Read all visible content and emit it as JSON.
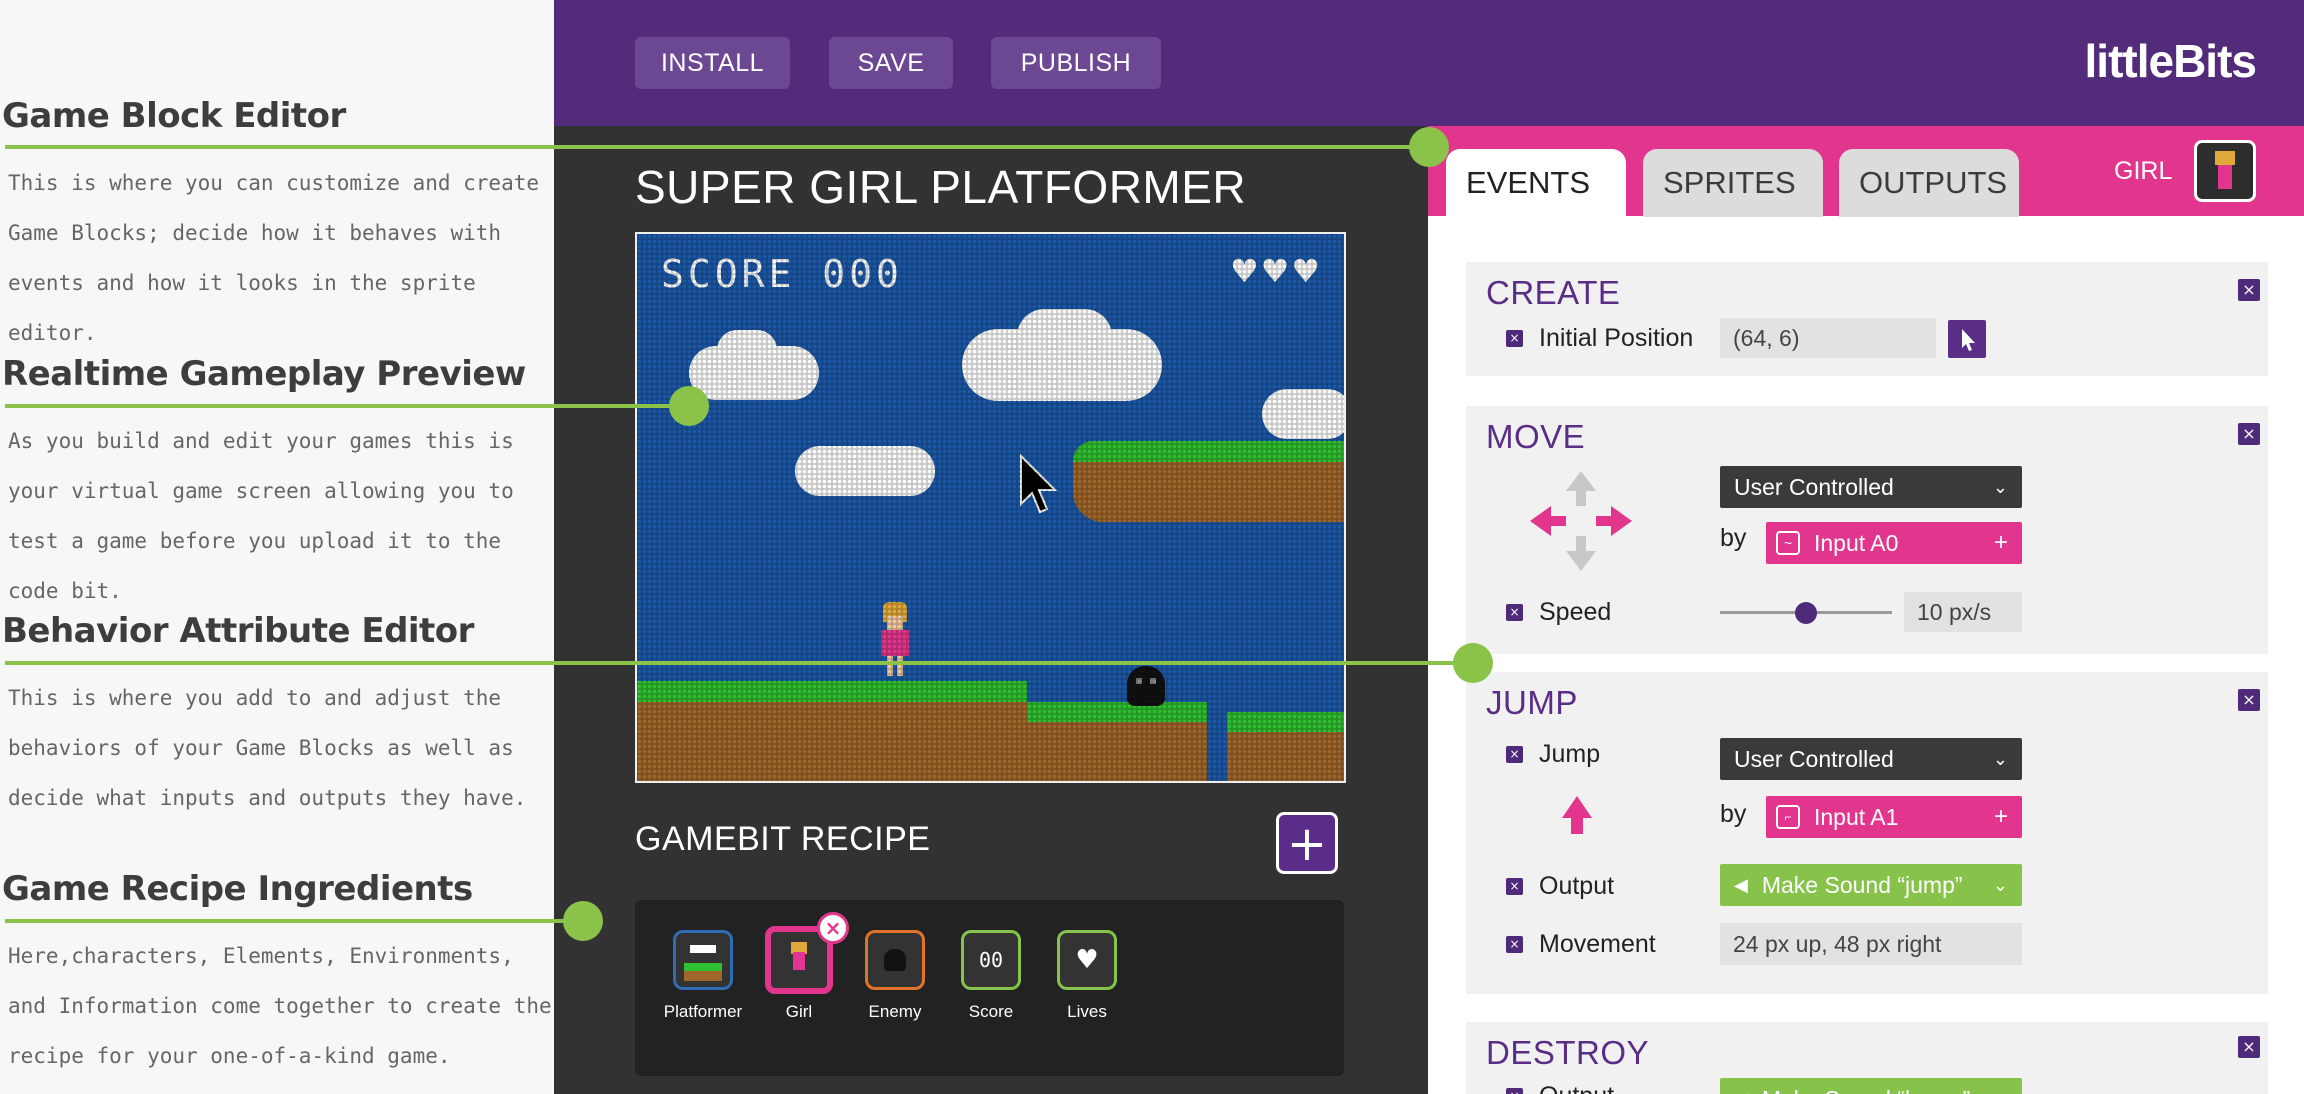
{
  "annotations": [
    {
      "title": "Game Block Editor",
      "desc": "This is where you can customize and create Game Blocks; decide how it behaves with events and how it looks in the sprite editor."
    },
    {
      "title": "Realtime Gameplay Preview",
      "desc": "As you build and edit your games this is your virtual game screen allowing you to test a game before you upload it to the code bit."
    },
    {
      "title": "Behavior Attribute Editor",
      "desc": "This is where you add to and adjust the behaviors of your Game Blocks as well as decide what inputs and outputs they have."
    },
    {
      "title": "Game Recipe Ingredients",
      "desc": "Here,characters, Elements, Environments, and Information come together to create the recipe for your one-of-a-kind game."
    }
  ],
  "toolbar": {
    "install": "INSTALL",
    "save": "SAVE",
    "publish": "PUBLISH",
    "logo": "littleBits"
  },
  "game": {
    "title": "SUPER GIRL PLATFORMER",
    "score": "SCORE 000",
    "hearts": "♥♥♥"
  },
  "recipe": {
    "title": "GAMEBIT RECIPE",
    "add": "+",
    "items": [
      {
        "label": "Platformer",
        "color": "#2f6db5"
      },
      {
        "label": "Girl",
        "color": "#e2368e"
      },
      {
        "label": "Enemy",
        "color": "#e0742a"
      },
      {
        "label": "Score",
        "color": "#87c24a"
      },
      {
        "label": "Lives",
        "color": "#87c24a"
      }
    ]
  },
  "tabs": {
    "events": "EVENTS",
    "sprites": "SPRITES",
    "outputs": "OUTPUTS",
    "selected_sprite": "GIRL"
  },
  "events": {
    "create": {
      "title": "CREATE",
      "initial_position_label": "Initial Position",
      "initial_position_value": "(64, 6)"
    },
    "move": {
      "title": "MOVE",
      "mode": "User Controlled",
      "by_label": "by",
      "input": "Input A0",
      "speed_label": "Speed",
      "speed_value": "10 px/s",
      "speed_level": 0.5
    },
    "jump": {
      "title": "JUMP",
      "jump_label": "Jump",
      "mode": "User Controlled",
      "by_label": "by",
      "input": "Input A1",
      "output_label": "Output",
      "output_value": "Make Sound “jump”",
      "movement_label": "Movement",
      "movement_value": "24 px up, 48 px right"
    },
    "destroy": {
      "title": "DESTROY",
      "output_label": "Output",
      "output_value": "Make Sound “boom”"
    }
  },
  "colors": {
    "purple": "#532b7b",
    "pink": "#e2368e",
    "green": "#8bc34a"
  }
}
